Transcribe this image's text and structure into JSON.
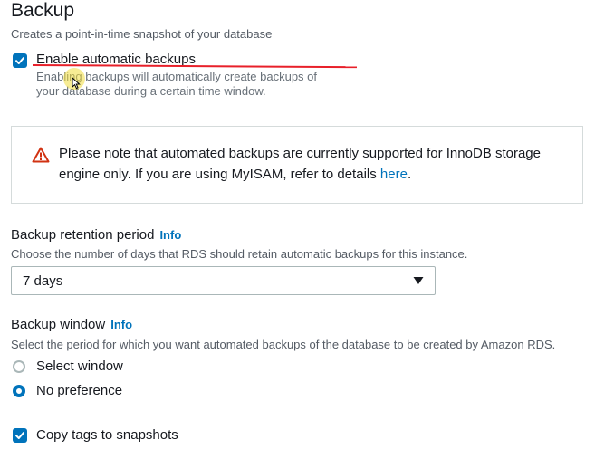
{
  "section": {
    "title": "Backup",
    "description": "Creates a point-in-time snapshot of your database"
  },
  "enable_backups": {
    "label": "Enable automatic backups",
    "checked": true,
    "description": "Enabling backups will automatically create backups of your database during a certain time window."
  },
  "alert": {
    "icon": "warning-icon",
    "text": "Please note that automated backups are currently supported for InnoDB storage engine only. If you are using MyISAM, refer to details",
    "link_text": "here",
    "suffix": "."
  },
  "retention": {
    "label": "Backup retention period",
    "info": "Info",
    "description": "Choose the number of days that RDS should retain automatic backups for this instance.",
    "selected": "7 days"
  },
  "window": {
    "label": "Backup window",
    "info": "Info",
    "description": "Select the period for which you want automated backups of the database to be created by Amazon RDS.",
    "options": [
      {
        "label": "Select window",
        "selected": false
      },
      {
        "label": "No preference",
        "selected": true
      }
    ]
  },
  "copy_tags": {
    "label": "Copy tags to snapshots",
    "checked": true
  },
  "colors": {
    "accent": "#0073bb",
    "annotation": "#e8202a",
    "warning": "#d13212"
  }
}
